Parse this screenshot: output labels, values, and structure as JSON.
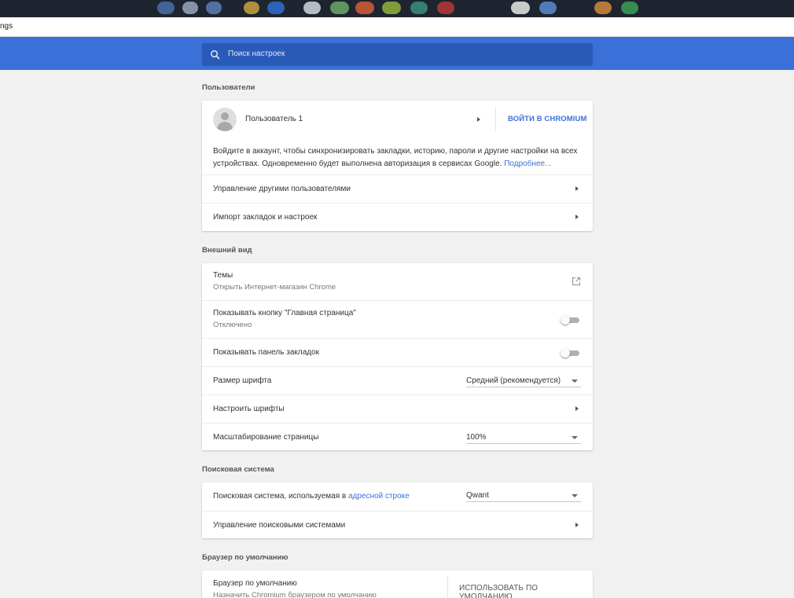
{
  "browser": {
    "url_fragment": "ngs"
  },
  "search": {
    "placeholder": "Поиск настроек"
  },
  "sections": {
    "users": {
      "title": "Пользователи",
      "profile_name": "Пользователь 1",
      "sign_in_button": "ВОЙТИ В CHROMIUM",
      "description": "Войдите в аккаунт, чтобы синхронизировать закладки, историю, пароли и другие настройки на всех устройствах. Одновременно будет выполнена авторизация в сервисах Google.",
      "learn_more": "Подробнее...",
      "manage_users": "Управление другими пользователями",
      "import": "Импорт закладок и настроек"
    },
    "appearance": {
      "title": "Внешний вид",
      "themes_label": "Темы",
      "themes_sub": "Открыть Интернет-магазин Chrome",
      "home_button_label": "Показывать кнопку \"Главная страница\"",
      "home_button_sub": "Отключено",
      "bookmarks_bar_label": "Показывать панель закладок",
      "font_size_label": "Размер шрифта",
      "font_size_value": "Средний (рекомендуется)",
      "customize_fonts": "Настроить шрифты",
      "page_zoom_label": "Масштабирование страницы",
      "page_zoom_value": "100%"
    },
    "search_engine": {
      "title": "Поисковая система",
      "engine_label_prefix": "Поисковая система, используемая в",
      "engine_label_link": "адресной строке",
      "engine_value": "Qwant",
      "manage_engines": "Управление поисковыми системами"
    },
    "default_browser": {
      "title": "Браузер по умолчанию",
      "label": "Браузер по умолчанию",
      "sub": "Назначить Chromium браузером по умолчанию",
      "button": "ИСПОЛЬЗОВАТЬ ПО УМОЛЧАНИЮ"
    }
  },
  "toggles": {
    "home_button": false,
    "bookmarks_bar": false
  },
  "colors": {
    "header_blue": "#3b70d9",
    "search_box": "#2a5ab8",
    "link_blue": "#3b70d9",
    "background": "#f1f1f1"
  },
  "icons": [
    "search-icon",
    "avatar-icon",
    "chevron-right-icon",
    "external-link-icon",
    "dropdown-arrow-icon"
  ]
}
